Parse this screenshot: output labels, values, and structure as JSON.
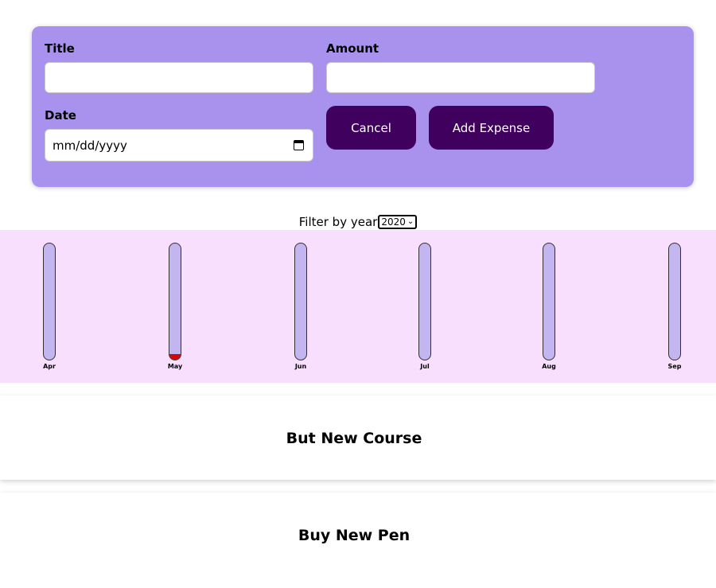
{
  "form": {
    "title_label": "Title",
    "title_value": "",
    "amount_label": "Amount",
    "amount_value": "",
    "date_label": "Date",
    "date_placeholder": "mm/dd/yyyy",
    "cancel_label": "Cancel",
    "add_label": "Add Expense"
  },
  "filter": {
    "label": "Filter by year",
    "selected_year": "2020"
  },
  "colors": {
    "form_bg": "#a892ee",
    "button_bg": "#40005d",
    "chart_bg": "#f8dffd",
    "bar_bg": "#c3b5f0",
    "bar_fill": "#d10909"
  },
  "chart": {
    "months": [
      {
        "label": "Apr",
        "fill_fraction": 0
      },
      {
        "label": "May",
        "fill_fraction": 0.05
      },
      {
        "label": "Jun",
        "fill_fraction": 0
      },
      {
        "label": "Jul",
        "fill_fraction": 0
      },
      {
        "label": "Aug",
        "fill_fraction": 0
      },
      {
        "label": "Sep",
        "fill_fraction": 0
      }
    ]
  },
  "expenses": [
    {
      "title": "But New Course"
    },
    {
      "title": "Buy New Pen"
    }
  ]
}
